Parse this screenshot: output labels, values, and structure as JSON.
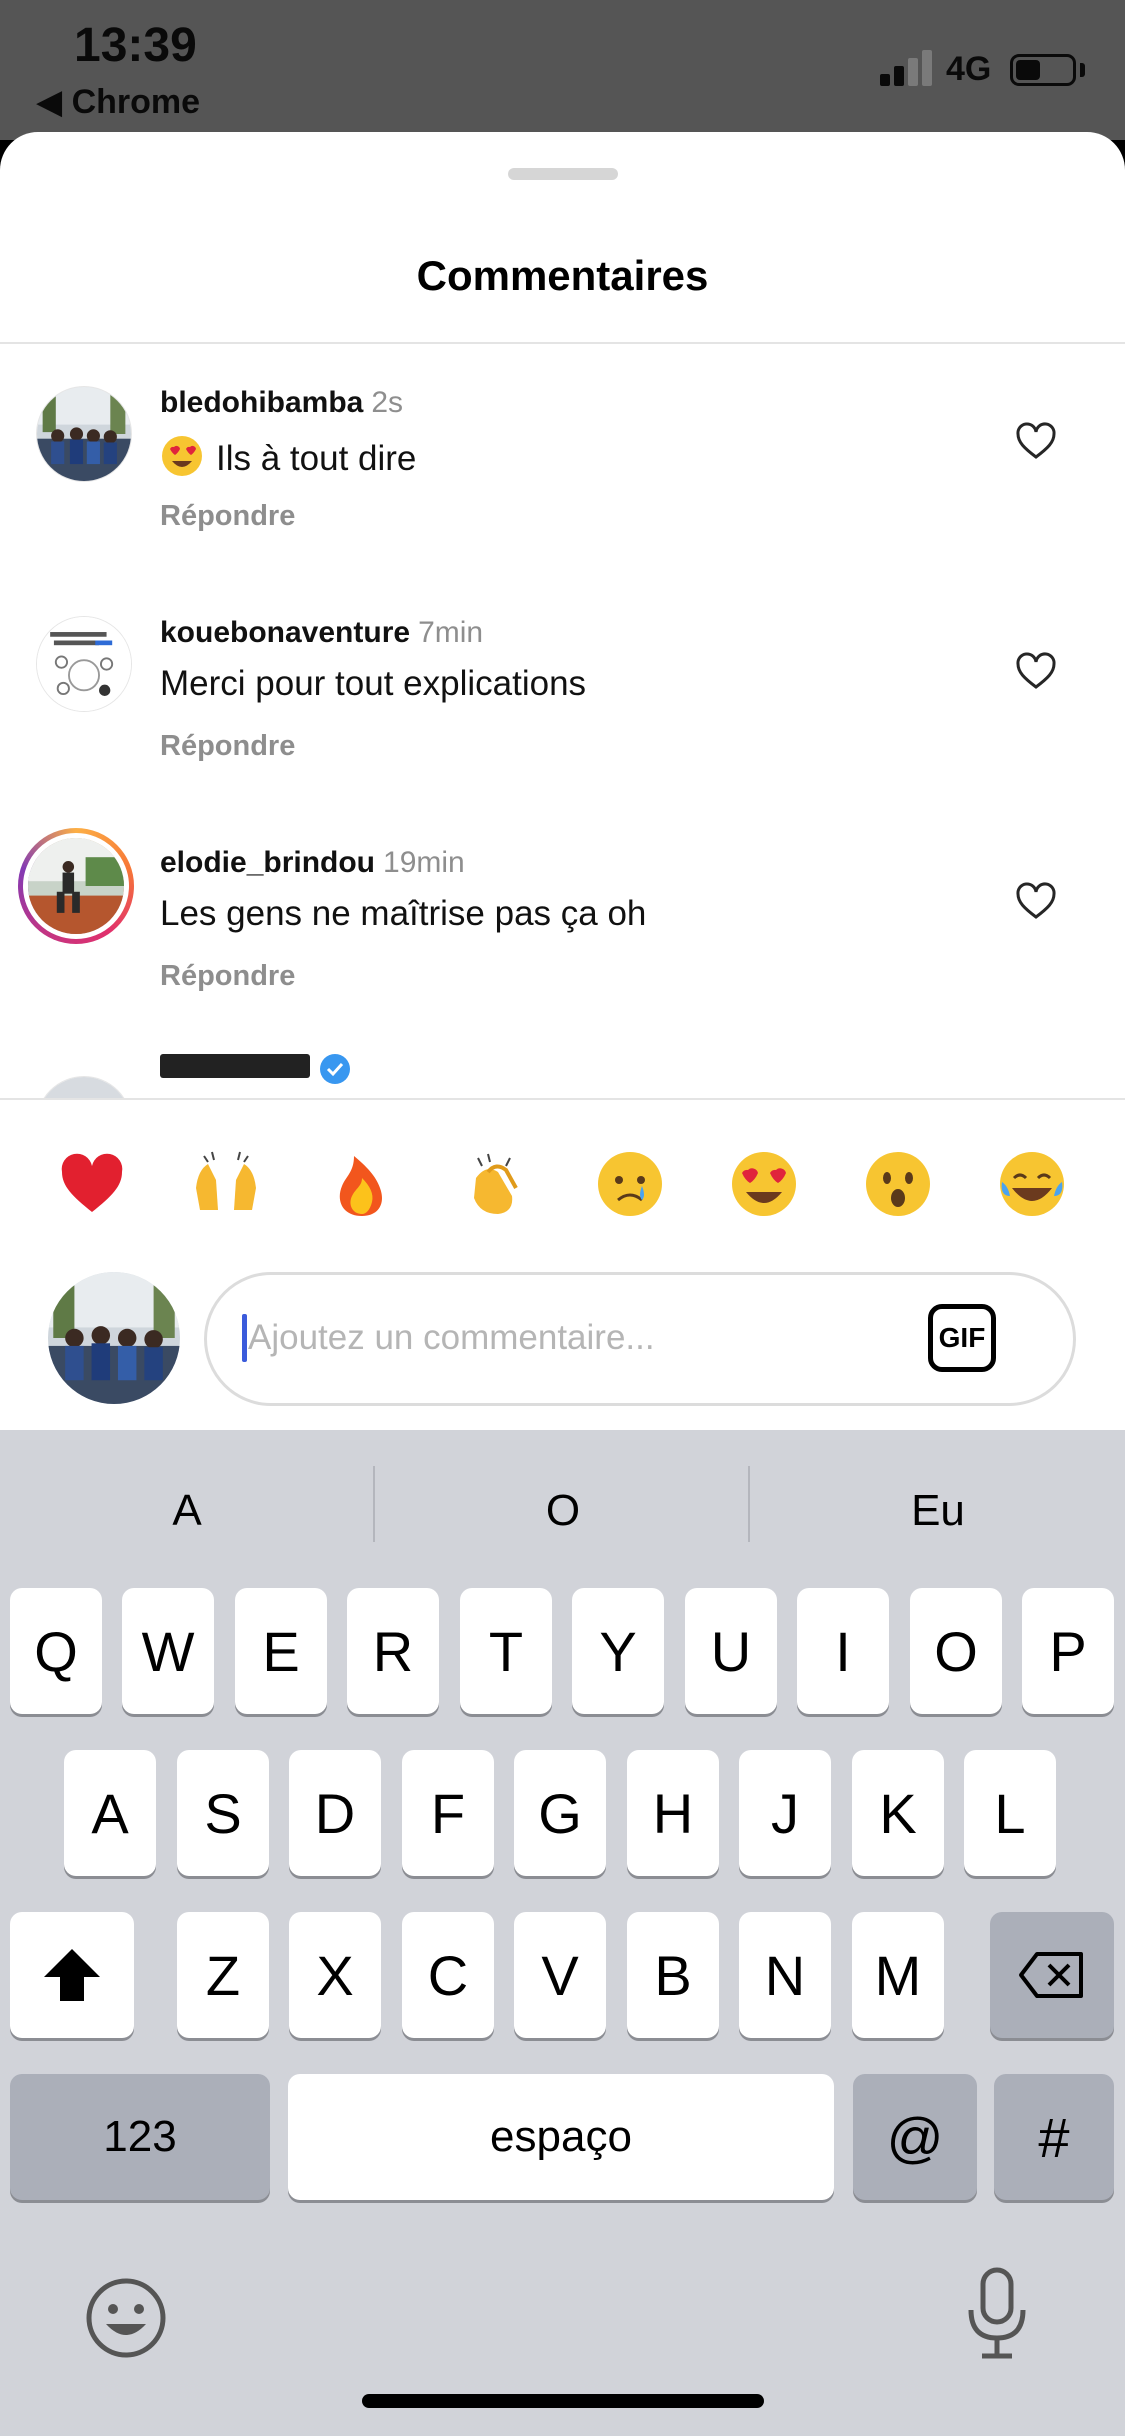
{
  "status_bar": {
    "time": "13:39",
    "back_app": "◀ Chrome",
    "network": "4G",
    "signal_strength": 0.5,
    "battery_level": 0.45
  },
  "sheet": {
    "title": "Commentaires"
  },
  "comments": [
    {
      "username": "bledohibamba",
      "time": "2s",
      "emoji": "heart-eyes",
      "text": "Ils à tout dire",
      "reply_label": "Répondre",
      "like_icon": "heart-outline-icon"
    },
    {
      "username": "kouebonaventure",
      "time": "7min",
      "text": "Merci pour tout explications",
      "reply_label": "Répondre",
      "like_icon": "heart-outline-icon"
    },
    {
      "username": "elodie_brindou",
      "time": "19min",
      "text": "Les gens ne maîtrise pas ça oh",
      "reply_label": "Répondre",
      "like_icon": "heart-outline-icon"
    },
    {
      "verified": true
    }
  ],
  "reaction_emojis": [
    "red-heart",
    "raising-hands",
    "fire",
    "clapping-hands",
    "crying-face",
    "heart-eyes",
    "surprised-face",
    "tears-of-joy"
  ],
  "composer": {
    "placeholder": "Ajoutez un commentaire...",
    "value": "",
    "gif_label": "GIF"
  },
  "keyboard": {
    "suggestions": [
      "A",
      "O",
      "Eu"
    ],
    "row1": [
      "Q",
      "W",
      "E",
      "R",
      "T",
      "Y",
      "U",
      "I",
      "O",
      "P"
    ],
    "row2": [
      "A",
      "S",
      "D",
      "F",
      "G",
      "H",
      "J",
      "K",
      "L"
    ],
    "row3": [
      "Z",
      "X",
      "C",
      "V",
      "B",
      "N",
      "M"
    ],
    "numbers_label": "123",
    "space_label": "espaço",
    "at_label": "@",
    "hash_label": "#"
  },
  "colors": {
    "accent_caret": "#3b5bdb",
    "muted_text": "#8e8e8e",
    "keyboard_bg": "#d1d3d9"
  }
}
